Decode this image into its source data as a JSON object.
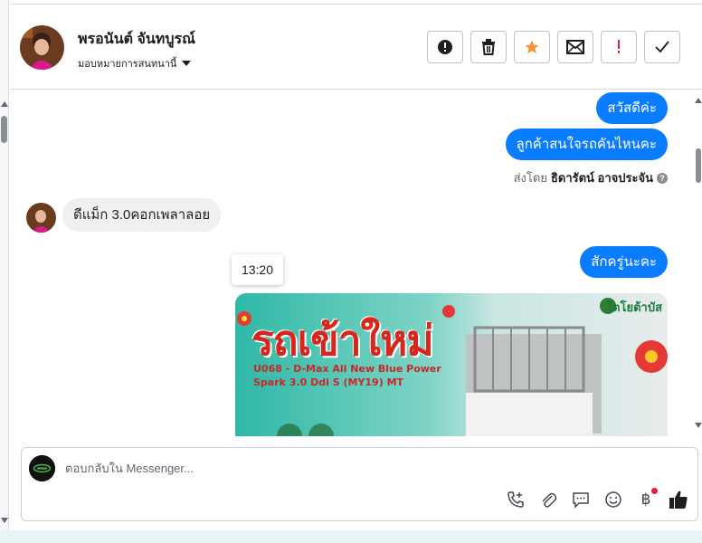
{
  "header": {
    "contact_name": "พรอนันต์ จันทบูรณ์",
    "assign_label": "มอบหมายการสนทนานี้",
    "actions": [
      {
        "name": "mark-spam-button",
        "icon": "exclamation-circle-icon"
      },
      {
        "name": "delete-button",
        "icon": "trash-icon"
      },
      {
        "name": "star-button",
        "icon": "star-icon",
        "color": "#f7923b"
      },
      {
        "name": "mark-unread-button",
        "icon": "envelope-icon"
      },
      {
        "name": "follow-up-button",
        "icon": "exclamation-icon",
        "color": "#e41e3f"
      },
      {
        "name": "mark-done-button",
        "icon": "check-icon"
      }
    ]
  },
  "thread": {
    "out_messages": [
      "สวัสดีค่ะ",
      "ลูกค้าสนใจรถคันไหนคะ",
      "สักครู่นะคะ"
    ],
    "sent_by_prefix": "ส่งโดย",
    "sent_by_name": "ธิดารัตน์ อาจประจัน",
    "in_message": "ดีแม็ก 3.0คอกเพลาลอย",
    "timestamp_tooltip": "13:20",
    "promo": {
      "headline": "รถเข้าใหม่",
      "model_line1": "U068 - D-Max All New Blue Power",
      "model_line2": "Spark 3.0 Ddi S (MY19) MT",
      "logo": "โตโยต้าบัส"
    }
  },
  "composer": {
    "placeholder": "ตอบกลับใน Messenger...",
    "tools": [
      "call-add-icon",
      "paperclip-icon",
      "saved-reply-icon",
      "emoji-icon",
      "baht-icon",
      "thumbs-up-icon"
    ]
  },
  "colors": {
    "accent": "#0a7cff",
    "star": "#f7923b",
    "alert": "#e41e3f"
  }
}
